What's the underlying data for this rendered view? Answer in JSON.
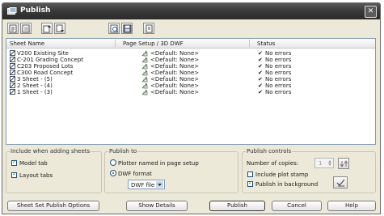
{
  "window": {
    "title": "Publish",
    "close_glyph": "✕"
  },
  "toolbar": {
    "buttons": [
      {
        "name": "add-sheets-button-icon"
      },
      {
        "name": "remove-sheets-button-icon"
      },
      {
        "name": "move-sheet-up-button-icon"
      },
      {
        "name": "move-sheet-down-button-icon"
      },
      {
        "name": "preview-button-icon"
      },
      {
        "name": "save-sheet-list-button-icon"
      },
      {
        "name": "load-sheet-list-button-icon"
      }
    ]
  },
  "list": {
    "columns": [
      "Sheet Name",
      "Page Setup / 3D DWF",
      "Status"
    ],
    "rows": [
      {
        "sheet": "V200 Existing Site",
        "setup": "<Default: None>",
        "status": "No errors"
      },
      {
        "sheet": "C-201 Grading Concept",
        "setup": "<Default: None>",
        "status": "No errors"
      },
      {
        "sheet": "C203 Proposed Lots",
        "setup": "<Default: None>",
        "status": "No errors"
      },
      {
        "sheet": "C300 Road Concept",
        "setup": "<Default: None>",
        "status": "No errors"
      },
      {
        "sheet": "3 Sheet - (5)",
        "setup": "<Default: None>",
        "status": "No errors"
      },
      {
        "sheet": "2 Sheet - (4)",
        "setup": "<Default: None>",
        "status": "No errors"
      },
      {
        "sheet": "1 Sheet - (3)",
        "setup": "<Default: None>",
        "status": "No errors"
      }
    ]
  },
  "include_group": {
    "title": "Include when adding sheets",
    "model_tab": {
      "label": "Model tab",
      "checked": true
    },
    "layout_tabs": {
      "label": "Layout tabs",
      "checked": true
    }
  },
  "publish_to_group": {
    "title": "Publish to",
    "plotter_option": {
      "label": "Plotter named in page setup",
      "selected": false
    },
    "dwf_option": {
      "label": "DWF format",
      "selected": true
    },
    "format_select": {
      "value": "DWF file"
    }
  },
  "controls_group": {
    "title": "Publish controls",
    "copies_label": "Number of copies:",
    "copies_value": "1",
    "include_plot_stamp": {
      "label": "Include plot stamp",
      "checked": false
    },
    "publish_background": {
      "label": "Publish in background",
      "checked": true
    }
  },
  "buttons": {
    "sheet_set_options": "Sheet Set Publish Options",
    "show_details": "Show Details",
    "publish": "Publish",
    "cancel": "Cancel",
    "help": "Help"
  }
}
